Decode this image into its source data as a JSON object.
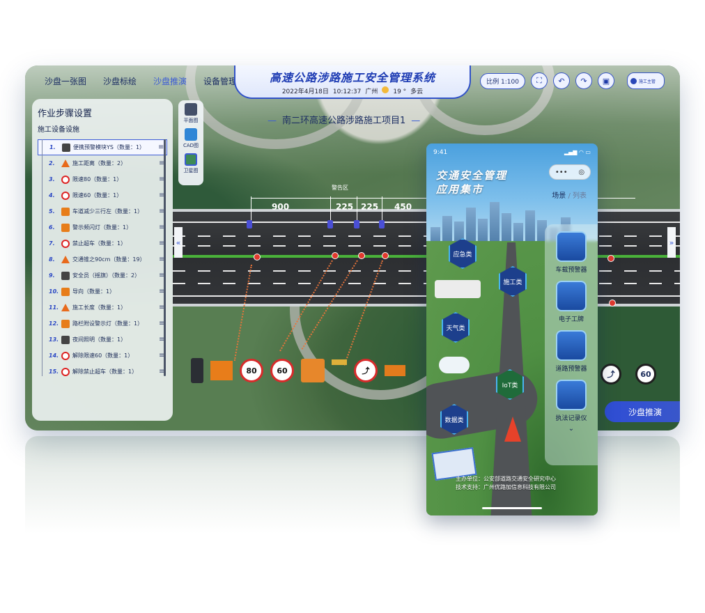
{
  "header": {
    "title": "高速公路涉路施工安全管理系统",
    "date": "2022年4月18日",
    "time": "10:12:37",
    "city": "广州",
    "temp": "19 °",
    "weather": "多云",
    "nav_tabs": [
      {
        "label": "沙盘一张图",
        "active": false
      },
      {
        "label": "沙盘标绘",
        "active": false
      },
      {
        "label": "沙盘推演",
        "active": true
      },
      {
        "label": "设备管理",
        "active": false
      }
    ],
    "scale_label": "比例 1:100",
    "user_role": "施工主管"
  },
  "project_title": "南二环高速公路涉路施工项目1",
  "panel": {
    "title": "作业步骤设置",
    "subtitle": "施工设备设施",
    "steps": [
      {
        "no": "1.",
        "label": "便携预警模块YS（数量：1）"
      },
      {
        "no": "2.",
        "label": "施工距离（数量：2）"
      },
      {
        "no": "3.",
        "label": "限速80（数量：1）"
      },
      {
        "no": "4.",
        "label": "限速60（数量：1）"
      },
      {
        "no": "5.",
        "label": "车道减少三行左（数量：1）"
      },
      {
        "no": "6.",
        "label": "警示频闪灯（数量：1）"
      },
      {
        "no": "7.",
        "label": "禁止超车（数量：1）"
      },
      {
        "no": "8.",
        "label": "交通锥之90cm（数量：19）"
      },
      {
        "no": "9.",
        "label": "安全员（摇旗）（数量：2）"
      },
      {
        "no": "10.",
        "label": "导向（数量：1）"
      },
      {
        "no": "11.",
        "label": "施工长度（数量：1）"
      },
      {
        "no": "12.",
        "label": "路栏附设警示灯（数量：1）"
      },
      {
        "no": "13.",
        "label": "夜间照明（数量：1）"
      },
      {
        "no": "14.",
        "label": "解除限速60（数量：1）"
      },
      {
        "no": "15.",
        "label": "解除禁止超车（数量：1）"
      }
    ]
  },
  "views": [
    {
      "label": "平面图"
    },
    {
      "label": "CAD图"
    },
    {
      "label": "卫星图"
    }
  ],
  "road": {
    "zone_label": "警告区",
    "distances": [
      "900",
      "225",
      "225",
      "450"
    ]
  },
  "device_signs": [
    "80",
    "60"
  ],
  "right_signs": [
    "60"
  ],
  "deduce_button": "沙盘推演",
  "phone": {
    "time": "9:41",
    "app_title_line1": "交通安全管理",
    "app_title_line2": "应用集市",
    "view_switch": {
      "scene": "场景",
      "sep": "/",
      "list": "列表"
    },
    "categories": [
      "应急类",
      "施工类",
      "天气类",
      "IoT类",
      "数据类"
    ],
    "rail_items": [
      "车载预警器",
      "电子工牌",
      "道路预警器",
      "执法记录仪"
    ],
    "footer_host": "主办单位：公安部道路交通安全研究中心",
    "footer_tech": "技术支持：广州优路加信息科技有限公司"
  },
  "colors": {
    "accent": "#3b5bd6",
    "title": "#1d3bb3",
    "median": "#4ab23a"
  }
}
